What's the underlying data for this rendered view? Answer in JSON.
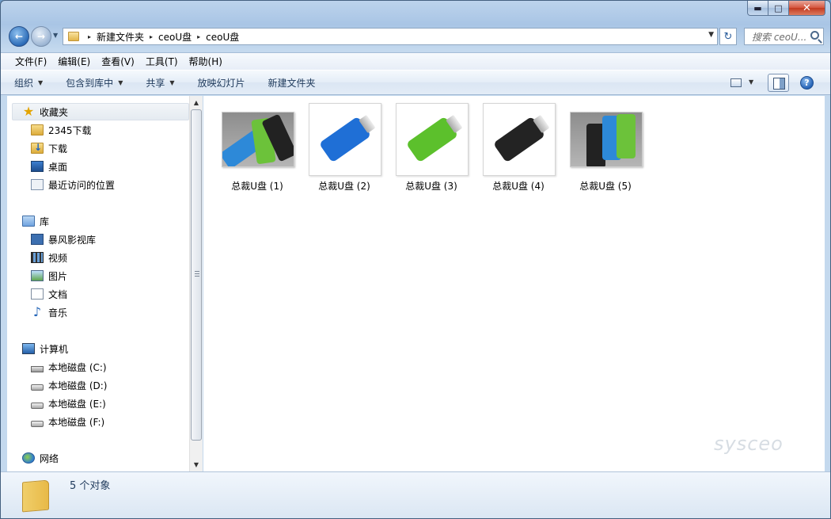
{
  "window": {
    "caption": {
      "min": "▬",
      "max": "□",
      "close": "✕"
    }
  },
  "address": {
    "crumbs": [
      "新建文件夹",
      "ceoU盘",
      "ceoU盘"
    ],
    "separator": "▸",
    "search_placeholder": "搜索 ceoU..."
  },
  "menu": [
    "文件(F)",
    "编辑(E)",
    "查看(V)",
    "工具(T)",
    "帮助(H)"
  ],
  "toolbar": {
    "organize": "组织",
    "include_library": "包含到库中",
    "share": "共享",
    "slideshow": "放映幻灯片",
    "new_folder": "新建文件夹",
    "dropdown_arrow": "▼",
    "help": "?"
  },
  "sidebar": {
    "favorites": {
      "header": "收藏夹",
      "items": [
        "2345下载",
        "下载",
        "桌面",
        "最近访问的位置"
      ]
    },
    "libraries": {
      "header": "库",
      "items": [
        "暴风影视库",
        "视频",
        "图片",
        "文档",
        "音乐"
      ]
    },
    "computer": {
      "header": "计算机",
      "items": [
        "本地磁盘 (C:)",
        "本地磁盘 (D:)",
        "本地磁盘 (E:)",
        "本地磁盘 (F:)"
      ]
    },
    "network": {
      "header": "网络"
    }
  },
  "files": [
    {
      "name": "总裁U盘 (1)",
      "colors": [
        "#2d89d8",
        "#6cc23a",
        "#222222"
      ],
      "thumb": "wide"
    },
    {
      "name": "总裁U盘 (2)",
      "colors": [
        "#1f6fd6"
      ],
      "thumb": "square"
    },
    {
      "name": "总裁U盘 (3)",
      "colors": [
        "#5cc02c"
      ],
      "thumb": "square"
    },
    {
      "name": "总裁U盘 (4)",
      "colors": [
        "#232323"
      ],
      "thumb": "square"
    },
    {
      "name": "总裁U盘 (5)",
      "colors": [
        "#222222",
        "#2d89d8",
        "#6cc23a"
      ],
      "thumb": "wide"
    }
  ],
  "status": {
    "count": "5 个对象"
  },
  "watermark": "sysceo"
}
